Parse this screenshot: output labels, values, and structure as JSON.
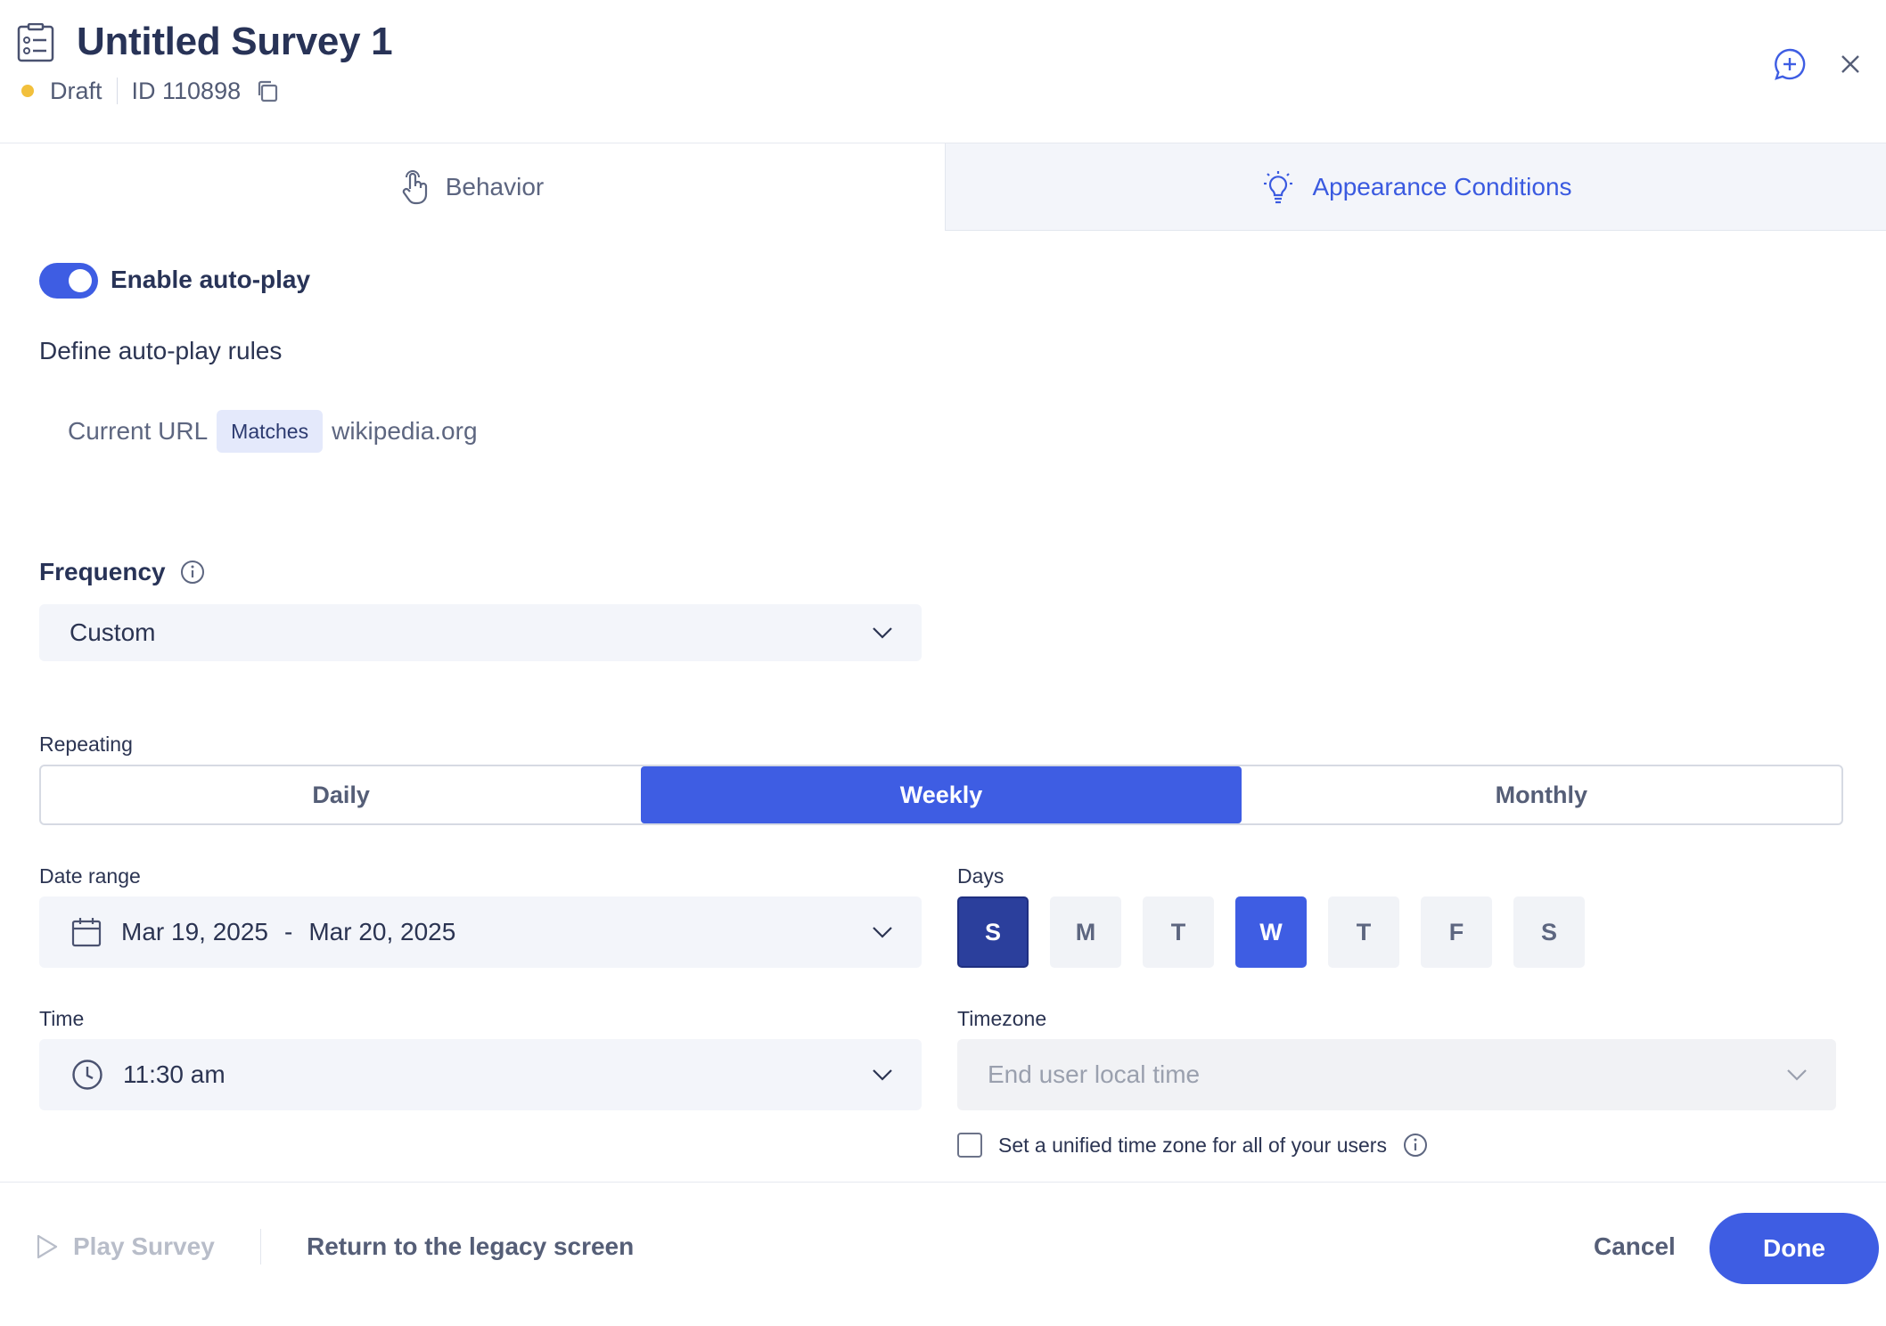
{
  "header": {
    "title": "Untitled Survey 1",
    "status": "Draft",
    "status_color": "#f2c03c",
    "id_label": "ID 110898",
    "icons": [
      "survey-icon",
      "copy-icon",
      "add-comment-icon",
      "close-icon"
    ]
  },
  "tabs": [
    {
      "label": "Behavior",
      "icon": "hand-pointer-icon",
      "active": false
    },
    {
      "label": "Appearance Conditions",
      "icon": "lightbulb-icon",
      "active": true
    }
  ],
  "autoplay": {
    "toggle_label": "Enable auto-play",
    "enabled": true
  },
  "rules": {
    "title": "Define auto-play rules",
    "field": "Current URL",
    "operator": "Matches",
    "value": "wikipedia.org"
  },
  "frequency": {
    "label": "Frequency",
    "selected": "Custom"
  },
  "repeating": {
    "label": "Repeating",
    "options": [
      "Daily",
      "Weekly",
      "Monthly"
    ],
    "selected": "Weekly"
  },
  "date_range": {
    "label": "Date range",
    "start": "Mar 19, 2025",
    "separator": "-",
    "end": "Mar 20, 2025"
  },
  "days": {
    "label": "Days",
    "items": [
      "S",
      "M",
      "T",
      "W",
      "T",
      "F",
      "S"
    ]
  },
  "time": {
    "label": "Time",
    "value": "11:30 am"
  },
  "timezone": {
    "label": "Timezone",
    "placeholder": "End user local time",
    "unified_label": "Set a unified time zone for all of your users"
  },
  "footer": {
    "play_label": "Play Survey",
    "legacy_label": "Return to the legacy screen",
    "cancel_label": "Cancel",
    "done_label": "Done"
  },
  "colors": {
    "accent": "#3e5de3",
    "title": "#283357"
  }
}
